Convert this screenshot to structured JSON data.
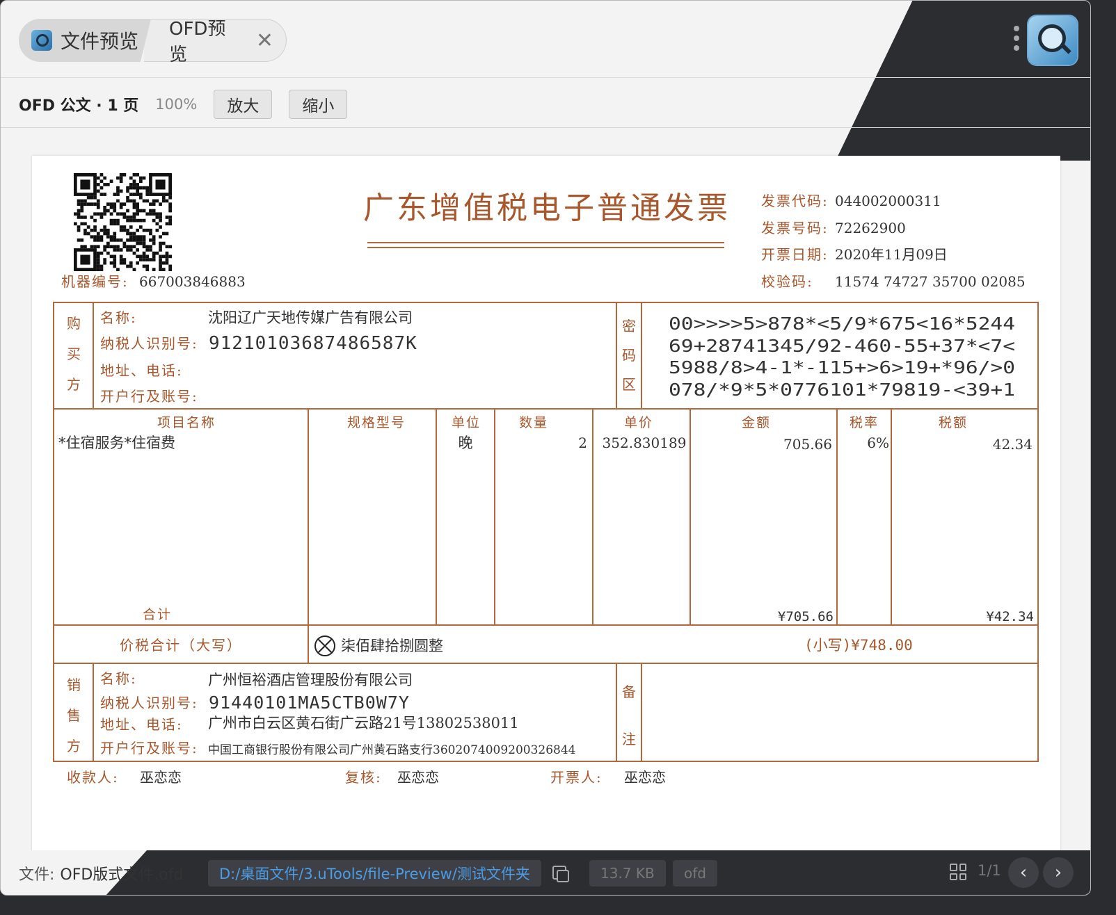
{
  "tabs": [
    {
      "label": "文件预览"
    },
    {
      "label": "OFD预览"
    }
  ],
  "toolbar": {
    "title": "OFD 公文 · 1 页",
    "zoom": "100%",
    "zoom_in_label": "放大",
    "zoom_out_label": "缩小"
  },
  "invoice": {
    "title": "广东增值税电子普通发票",
    "machine_label": "机器编号:",
    "machine_no": "667003846883",
    "header_fields": [
      {
        "label": "发票代码:",
        "value": "044002000311"
      },
      {
        "label": "发票号码:",
        "value": "72262900"
      },
      {
        "label": "开票日期:",
        "value": "2020年11月09日"
      },
      {
        "label": "校验码:",
        "value": "11574 74727 35700 02085"
      }
    ],
    "buyer": {
      "side_label": [
        "购",
        "买",
        "方"
      ],
      "name_label": "名称:",
      "name": "沈阳辽广天地传媒广告有限公司",
      "tax_label": "纳税人识别号:",
      "tax_id": "91210103687486587K",
      "addr_label": "地址、电话:",
      "addr": "",
      "bank_label": "开户行及账号:",
      "bank": ""
    },
    "cipher": {
      "side_label": [
        "密",
        "码",
        "区"
      ],
      "lines": [
        "00>>>>5>878*<5/9*675<16*5244",
        "69+28741345/92-460-55+37*<7<",
        "5988/8>4-1*-115+>6>19+*96/>0",
        "078/*9*5*0776101*79819-<39+1"
      ]
    },
    "columns": [
      "项目名称",
      "规格型号",
      "单位",
      "数量",
      "单价",
      "金额",
      "税率",
      "税额"
    ],
    "items": [
      {
        "name": "*住宿服务*住宿费",
        "spec": "",
        "unit": "晚",
        "qty": "2",
        "price": "352.830189",
        "amount": "705.66",
        "rate": "6%",
        "tax": "42.34"
      }
    ],
    "total_label": "合计",
    "total_amount": "¥705.66",
    "total_tax": "¥42.34",
    "grand_label": "价税合计（大写）",
    "grand_upper": "柒佰肆拾捌圆整",
    "grand_lower": "(小写)¥748.00",
    "seller": {
      "side_label": [
        "销",
        "售",
        "方"
      ],
      "name_label": "名称:",
      "name": "广州恒裕酒店管理股份有限公司",
      "tax_label": "纳税人识别号:",
      "tax_id": "91440101MA5CTB0W7Y",
      "addr_label": "地址、电话:",
      "addr": "广州市白云区黄石街广云路21号13802538011",
      "bank_label": "开户行及账号:",
      "bank": "中国工商银行股份有限公司广州黄石路支行3602074009200326844"
    },
    "remark_label": [
      "备",
      "注"
    ],
    "footer": [
      {
        "label": "收款人:",
        "value": "巫恋恋"
      },
      {
        "label": "复核:",
        "value": "巫恋恋"
      },
      {
        "label": "开票人:",
        "value": "巫恋恋"
      }
    ],
    "colors": {
      "line": "#b5663a",
      "label": "#a8562b",
      "text": "#333333"
    }
  },
  "statusbar": {
    "file_label": "文件:",
    "file_name": "OFD版式文件.ofd",
    "path": "D:/桌面文件/3.uTools/file-Preview/测试文件夹",
    "size": "13.7 KB",
    "type": "ofd",
    "page": "1/1"
  }
}
